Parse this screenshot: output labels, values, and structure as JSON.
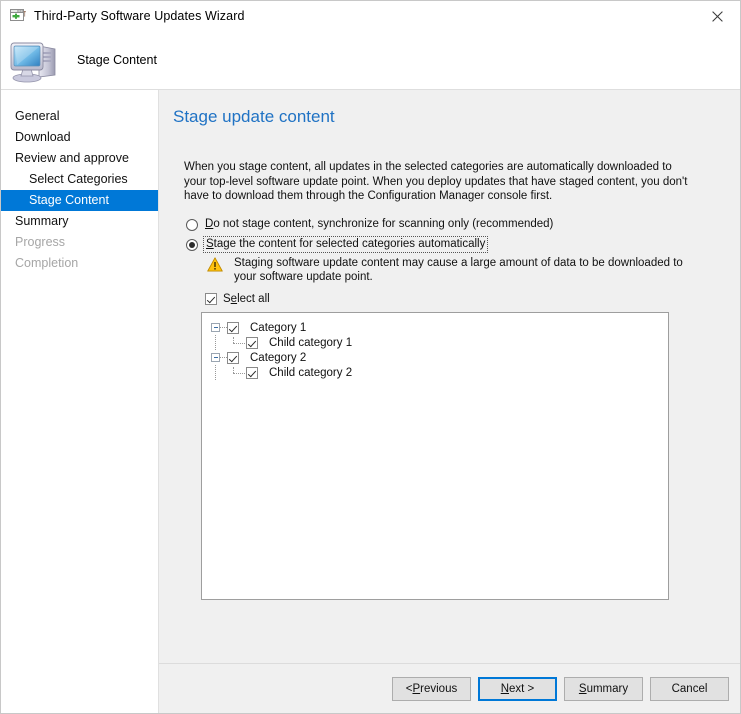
{
  "window": {
    "title": "Third-Party Software Updates Wizard",
    "title_icon": "wizard-window-icon",
    "close_label": "×"
  },
  "header": {
    "icon": "computer-icon",
    "title": "Stage Content"
  },
  "sidebar": {
    "items": [
      {
        "label": "General",
        "state": "normal",
        "level": 0
      },
      {
        "label": "Download",
        "state": "normal",
        "level": 0
      },
      {
        "label": "Review and approve",
        "state": "normal",
        "level": 0
      },
      {
        "label": "Select Categories",
        "state": "normal",
        "level": 1
      },
      {
        "label": "Stage Content",
        "state": "selected",
        "level": 1
      },
      {
        "label": "Summary",
        "state": "normal",
        "level": 0
      },
      {
        "label": "Progress",
        "state": "disabled",
        "level": 0
      },
      {
        "label": "Completion",
        "state": "disabled",
        "level": 0
      }
    ]
  },
  "main": {
    "heading": "Stage update content",
    "intro": "When you stage content, all updates in the selected categories are automatically downloaded to your top-level software update point. When you deploy updates that have staged content, you don't have to download them through the Configuration Manager console first.",
    "radios": [
      {
        "label": "Do not stage content, synchronize for scanning only (recommended)",
        "accelerator": "D",
        "checked": false,
        "focused": false
      },
      {
        "label": "Stage the content for selected categories automatically",
        "accelerator": "S",
        "checked": true,
        "focused": true
      }
    ],
    "warning": {
      "icon": "warning-triangle-icon",
      "text": "Staging software update content may cause a large amount of data to be downloaded to your software update point."
    },
    "select_all": {
      "label": "Select all",
      "accelerator": "e",
      "checked": true
    },
    "tree": [
      {
        "label": "Category 1",
        "level": 0,
        "checked": true,
        "expanded": true
      },
      {
        "label": "Child category 1",
        "level": 1,
        "checked": true,
        "expanded": null
      },
      {
        "label": "Category 2",
        "level": 0,
        "checked": true,
        "expanded": true
      },
      {
        "label": "Child category 2",
        "level": 1,
        "checked": true,
        "expanded": null
      }
    ]
  },
  "footer": {
    "buttons": [
      {
        "label": "< Previous",
        "accelerator": "P",
        "focused": false
      },
      {
        "label": "Next >",
        "accelerator": "N",
        "focused": true
      },
      {
        "label": "Summary",
        "accelerator": "S",
        "focused": false
      },
      {
        "label": "Cancel",
        "accelerator": "",
        "focused": false
      }
    ]
  },
  "colors": {
    "accent": "#0078d7",
    "heading": "#1f72c4",
    "window_bg": "#f0f0f0",
    "panel_bg": "#ffffff",
    "warning": "#ffc20e",
    "disabled_text": "#a6a6a6"
  }
}
